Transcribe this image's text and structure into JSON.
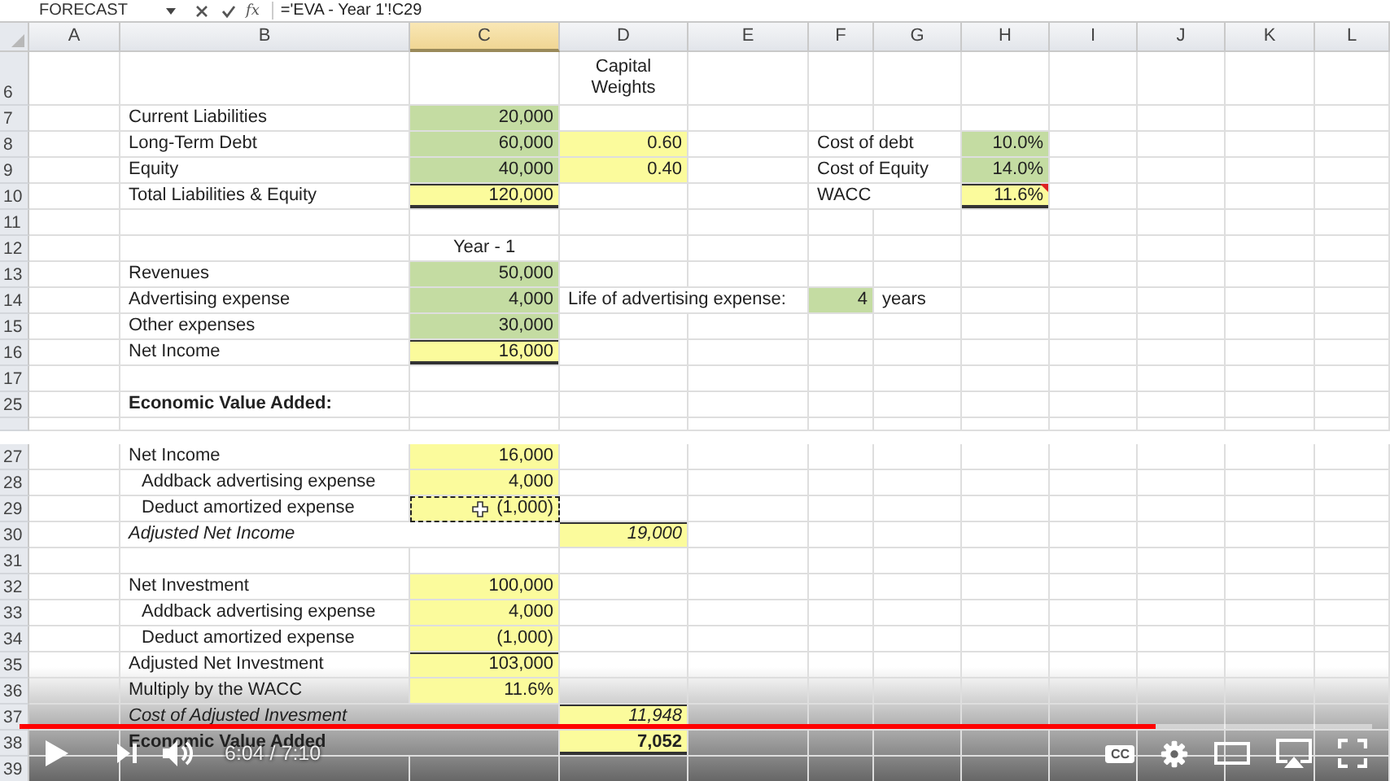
{
  "formula_bar": {
    "name_box": "FORECAST",
    "function_label": "fx",
    "formula": "='EVA - Year 1'!C29"
  },
  "sheet": {
    "columns": [
      {
        "label": "A",
        "selected": false
      },
      {
        "label": "B",
        "selected": false
      },
      {
        "label": "C",
        "selected": true
      },
      {
        "label": "D",
        "selected": false
      },
      {
        "label": "E",
        "selected": false
      },
      {
        "label": "F",
        "selected": false
      },
      {
        "label": "G",
        "selected": false
      },
      {
        "label": "H",
        "selected": false
      },
      {
        "label": "I",
        "selected": false
      },
      {
        "label": "J",
        "selected": false
      },
      {
        "label": "K",
        "selected": false
      },
      {
        "label": "L",
        "selected": false
      }
    ],
    "rows": [
      {
        "number": "6",
        "cells": [
          {},
          {},
          {},
          {
            "text": "Capital Weights",
            "kind": "heading"
          }
        ]
      },
      {
        "number": "7",
        "cells": [
          {},
          {
            "text": "Current Liabilities",
            "kind": "label"
          },
          {
            "text": "20,000",
            "kind": "figure",
            "color": "#c4dca2"
          }
        ]
      },
      {
        "number": "8",
        "cells": [
          {},
          {
            "text": "Long-Term Debt",
            "kind": "label"
          },
          {
            "text": "60,000",
            "kind": "figure",
            "color": "#c4dca2"
          },
          {
            "text": "0.60",
            "kind": "figure",
            "color": "#fbfb9c"
          },
          {},
          {
            "text": "Cost of debt",
            "kind": "label"
          },
          {},
          {
            "text": "10.0%",
            "kind": "figure",
            "color": "#c4dca2"
          }
        ]
      },
      {
        "number": "9",
        "cells": [
          {},
          {
            "text": "Equity",
            "kind": "label"
          },
          {
            "text": "40,000",
            "kind": "figure",
            "color": "#c4dca2"
          },
          {
            "text": "0.40",
            "kind": "figure",
            "color": "#fbfb9c"
          },
          {},
          {
            "text": "Cost of Equity",
            "kind": "label"
          },
          {},
          {
            "text": "14.0%",
            "kind": "figure",
            "color": "#c4dca2"
          }
        ]
      },
      {
        "number": "10",
        "cells": [
          {},
          {
            "text": "Total Liabilities & Equity",
            "kind": "label"
          },
          {
            "text": "120,000",
            "kind": "total",
            "color": "#fbfb9c"
          },
          {},
          {},
          {
            "text": "WACC",
            "kind": "label"
          },
          {},
          {
            "text": "11.6%",
            "kind": "total",
            "color": "#fbfb9c",
            "comment": true
          }
        ]
      },
      {
        "number": "11",
        "cells": []
      },
      {
        "number": "12",
        "cells": [
          {},
          {},
          {
            "text": "Year - 1",
            "kind": "heading"
          }
        ]
      },
      {
        "number": "13",
        "cells": [
          {},
          {
            "text": "Revenues",
            "kind": "label"
          },
          {
            "text": "50,000",
            "kind": "figure",
            "color": "#c4dca2"
          }
        ]
      },
      {
        "number": "14",
        "cells": [
          {},
          {
            "text": "Advertising expense",
            "kind": "label"
          },
          {
            "text": "4,000",
            "kind": "figure",
            "color": "#c4dca2"
          },
          {
            "text": "Life of advertising expense:",
            "kind": "label"
          },
          {},
          {
            "text": "4",
            "kind": "figure",
            "color": "#c4dca2"
          },
          {
            "text": "years",
            "kind": "label"
          }
        ]
      },
      {
        "number": "15",
        "cells": [
          {},
          {
            "text": "Other expenses",
            "kind": "label"
          },
          {
            "text": "30,000",
            "kind": "figure",
            "color": "#c4dca2"
          }
        ]
      },
      {
        "number": "16",
        "cells": [
          {},
          {
            "text": "Net Income",
            "kind": "label"
          },
          {
            "text": "16,000",
            "kind": "total",
            "color": "#fbfb9c"
          }
        ]
      },
      {
        "number": "17",
        "cells": []
      },
      {
        "number": "25",
        "cells": [
          {},
          {
            "text": "Economic Value Added:",
            "kind": "boldlabel"
          }
        ]
      },
      {
        "cells": []
      },
      {
        "number": "27",
        "cells": [
          {},
          {
            "text": "Net Income",
            "kind": "label"
          },
          {
            "text": "16,000",
            "kind": "figure",
            "color": "#fbfb9c"
          }
        ]
      },
      {
        "number": "28",
        "cells": [
          {},
          {
            "text": "Addback advertising expense",
            "kind": "indented"
          },
          {
            "text": "4,000",
            "kind": "figure",
            "color": "#fbfb9c"
          }
        ]
      },
      {
        "number": "29",
        "cells": [
          {},
          {
            "text": "Deduct amortized expense",
            "kind": "indented"
          },
          {
            "text": "(1,000)",
            "kind": "figure",
            "color": "#fbfb9c",
            "copy_marquee": true
          }
        ]
      },
      {
        "number": "30",
        "cells": [
          {},
          {
            "text": "Adjusted Net Income",
            "kind": "italiclabel"
          },
          {},
          {
            "text": "19,000",
            "kind": "italicsubtotal",
            "color": "#fbfb9c"
          }
        ]
      },
      {
        "number": "31",
        "cells": []
      },
      {
        "number": "32",
        "cells": [
          {},
          {
            "text": "Net Investment",
            "kind": "label"
          },
          {
            "text": "100,000",
            "kind": "figure",
            "color": "#fbfb9c"
          }
        ]
      },
      {
        "number": "33",
        "cells": [
          {},
          {
            "text": "Addback advertising expense",
            "kind": "indented"
          },
          {
            "text": "4,000",
            "kind": "figure",
            "color": "#fbfb9c"
          }
        ]
      },
      {
        "number": "34",
        "cells": [
          {},
          {
            "text": "Deduct amortized expense",
            "kind": "indented"
          },
          {
            "text": "(1,000)",
            "kind": "figure",
            "color": "#fbfb9c"
          }
        ]
      },
      {
        "number": "35",
        "cells": [
          {},
          {
            "text": "Adjusted Net Investment",
            "kind": "label"
          },
          {
            "text": "103,000",
            "kind": "subtotal",
            "color": "#fbfb9c"
          }
        ]
      },
      {
        "number": "36",
        "cells": [
          {},
          {
            "text": "Multiply by the WACC",
            "kind": "label"
          },
          {
            "text": "11.6%",
            "kind": "figure",
            "color": "#fbfb9c"
          }
        ]
      },
      {
        "number": "37",
        "cells": [
          {},
          {
            "text": "Cost of Adjusted Invesment",
            "kind": "italiclabel"
          },
          {},
          {
            "text": "11,948",
            "kind": "italictotal",
            "color": "#fbfb9c"
          }
        ]
      },
      {
        "number": "38",
        "cells": [
          {},
          {
            "text": "Economic Value Added",
            "kind": "boldlabel"
          },
          {},
          {
            "text": "7,052",
            "kind": "boldtotal",
            "color": "#fbfb9c"
          }
        ]
      },
      {
        "number": "39",
        "cells": []
      }
    ]
  },
  "player": {
    "progress": {
      "level": 0.84
    },
    "time": "6:04 / 7:10",
    "captions_label": "CC"
  }
}
